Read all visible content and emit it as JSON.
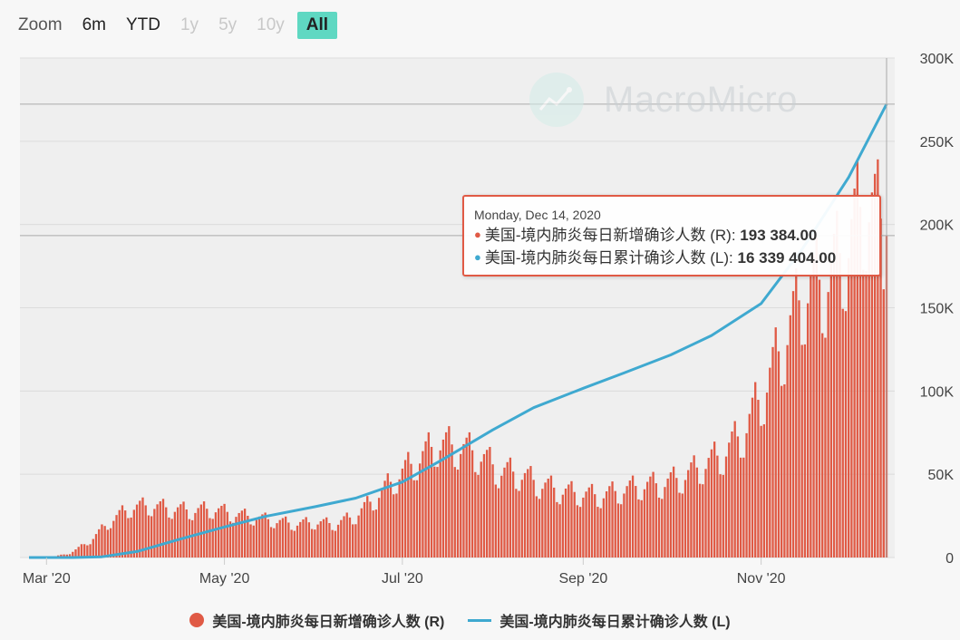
{
  "zoom": {
    "label": "Zoom",
    "buttons": [
      {
        "label": "6m",
        "state": "enabled"
      },
      {
        "label": "YTD",
        "state": "enabled"
      },
      {
        "label": "1y",
        "state": "disabled"
      },
      {
        "label": "5y",
        "state": "disabled"
      },
      {
        "label": "10y",
        "state": "disabled"
      },
      {
        "label": "All",
        "state": "active"
      }
    ]
  },
  "watermark": {
    "text": "MacroMicro"
  },
  "tooltip": {
    "date": "Monday, Dec 14, 2020",
    "rows": [
      {
        "series": "美国-境内肺炎每日新增确诊人数 (R)",
        "value": "193 384.00",
        "color": "#e05a45"
      },
      {
        "series": "美国-境内肺炎每日累计确诊人数 (L)",
        "value": "16 339 404.00",
        "color": "#3fa9d0"
      }
    ]
  },
  "legend": [
    {
      "label": "美国-境内肺炎每日新增确诊人数 (R)",
      "color": "#e05a45",
      "marker": "circle"
    },
    {
      "label": "美国-境内肺炎每日累计确诊人数 (L)",
      "color": "#3fa9d0",
      "marker": "line"
    }
  ],
  "colors": {
    "bar": "#e05a45",
    "line": "#3fa9d0",
    "active_button": "#5fd8c2"
  },
  "chart_data": {
    "type": "bar+line",
    "x_tick_labels": [
      "Mar '20",
      "May '20",
      "Jul '20",
      "Sep '20",
      "Nov '20"
    ],
    "x_ticks": [
      "2020-03-01",
      "2020-05-01",
      "2020-07-01",
      "2020-09-01",
      "2020-11-01"
    ],
    "x_range": [
      "2020-02-24",
      "2020-12-14"
    ],
    "right_axis": {
      "tick_labels": [
        "0",
        "50K",
        "100K",
        "150K",
        "200K",
        "250K",
        "300K"
      ],
      "ylim": [
        0,
        300000
      ]
    },
    "series": [
      {
        "name": "美国-境内肺炎每日新增确诊人数 (R)",
        "kind": "bar",
        "axis": "right",
        "weekly_dates": [
          "2020-02-24",
          "2020-03-02",
          "2020-03-09",
          "2020-03-16",
          "2020-03-23",
          "2020-03-30",
          "2020-04-06",
          "2020-04-13",
          "2020-04-20",
          "2020-04-27",
          "2020-05-04",
          "2020-05-11",
          "2020-05-18",
          "2020-05-25",
          "2020-06-01",
          "2020-06-08",
          "2020-06-15",
          "2020-06-22",
          "2020-06-29",
          "2020-07-06",
          "2020-07-13",
          "2020-07-20",
          "2020-07-27",
          "2020-08-03",
          "2020-08-10",
          "2020-08-17",
          "2020-08-24",
          "2020-08-31",
          "2020-09-07",
          "2020-09-14",
          "2020-09-21",
          "2020-09-28",
          "2020-10-05",
          "2020-10-12",
          "2020-10-19",
          "2020-10-26",
          "2020-11-02",
          "2020-11-09",
          "2020-11-16",
          "2020-11-23",
          "2020-11-30",
          "2020-12-07",
          "2020-12-14"
        ],
        "weekly_approx_daily_values": [
          0,
          100,
          2500,
          10000,
          22000,
          30000,
          31000,
          29000,
          28000,
          29000,
          26000,
          24000,
          22000,
          20000,
          21000,
          20000,
          25000,
          36000,
          48000,
          58000,
          68000,
          66000,
          62000,
          52000,
          50000,
          44000,
          40000,
          38000,
          37000,
          40000,
          43000,
          44000,
          48000,
          55000,
          62000,
          75000,
          100000,
          130000,
          160000,
          165000,
          185000,
          215000,
          193384
        ],
        "last_value": 193384
      },
      {
        "name": "美国-境内肺炎每日累计确诊人数 (L)",
        "kind": "line",
        "axis": "left",
        "dates": [
          "2020-02-24",
          "2020-03-10",
          "2020-03-20",
          "2020-04-01",
          "2020-04-15",
          "2020-05-01",
          "2020-05-15",
          "2020-06-01",
          "2020-06-15",
          "2020-07-01",
          "2020-07-15",
          "2020-08-01",
          "2020-08-15",
          "2020-09-01",
          "2020-09-15",
          "2020-10-01",
          "2020-10-15",
          "2020-11-01",
          "2020-11-15",
          "2020-12-01",
          "2020-12-14"
        ],
        "values": [
          0,
          800,
          25000,
          215000,
          640000,
          1100000,
          1480000,
          1830000,
          2140000,
          2720000,
          3540000,
          4600000,
          5400000,
          6100000,
          6650000,
          7300000,
          8000000,
          9150000,
          11100000,
          13700000,
          16339404
        ],
        "last_value": 16339404
      }
    ],
    "grid": true,
    "legend_position": "bottom-center"
  }
}
